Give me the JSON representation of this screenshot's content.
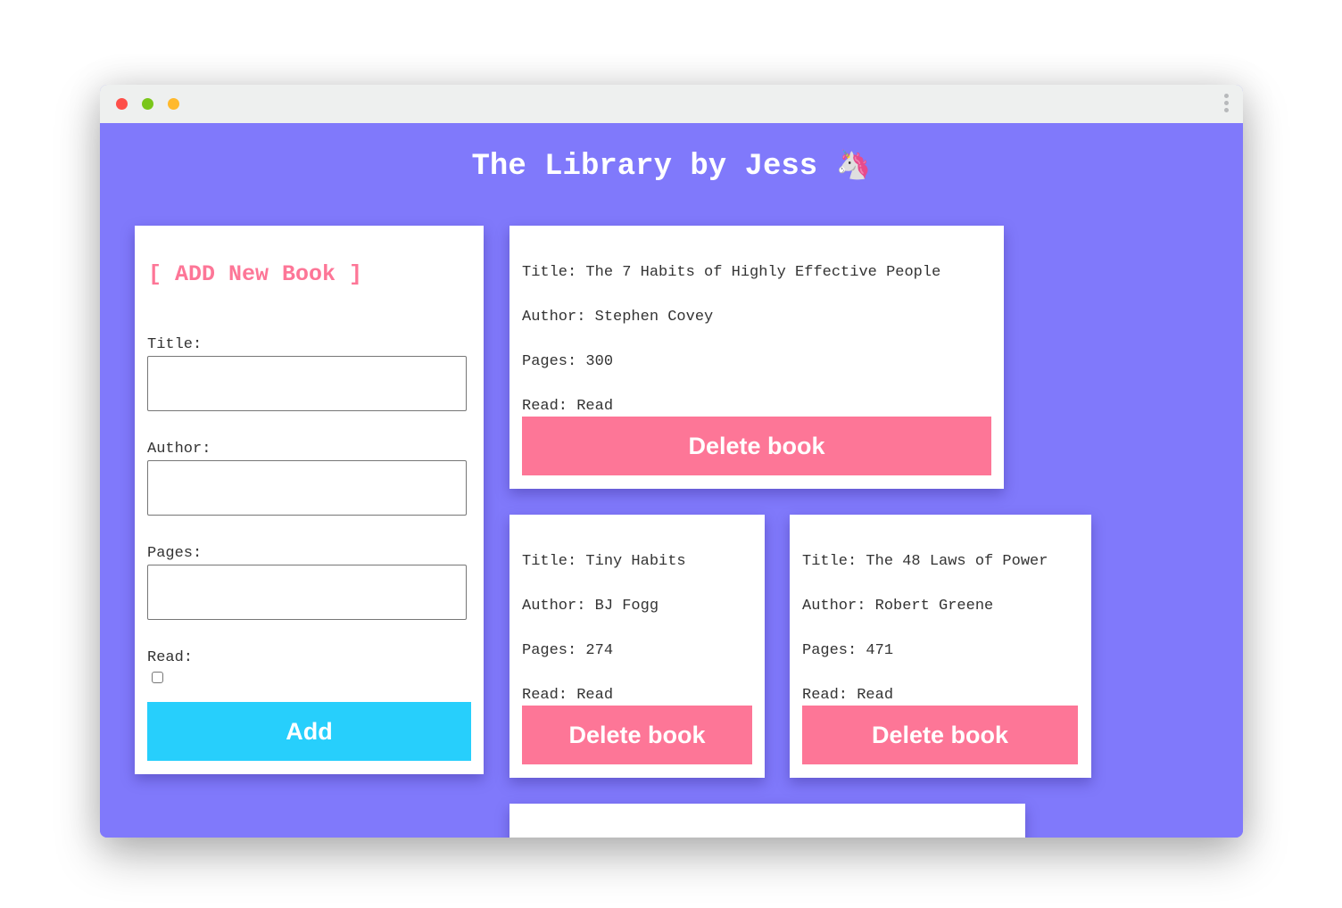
{
  "app": {
    "title": "The Library by Jess",
    "emoji": "🦄"
  },
  "form": {
    "heading": "[ ADD New Book ]",
    "title_label": "Title:",
    "title_value": "",
    "author_label": "Author:",
    "author_value": "",
    "pages_label": "Pages:",
    "pages_value": "",
    "read_label": "Read:",
    "read_checked": false,
    "add_label": "Add"
  },
  "books": [
    {
      "title": "Title: The 7 Habits of Highly Effective People",
      "author": "Author: Stephen Covey",
      "pages": "Pages: 300",
      "read": "Read: Read",
      "delete_label": "Delete book"
    },
    {
      "title": "Title: Tiny Habits",
      "author": "Author: BJ Fogg",
      "pages": "Pages: 274",
      "read": "Read: Read",
      "delete_label": "Delete book"
    },
    {
      "title": "Title: The 48 Laws of Power",
      "author": "Author: Robert Greene",
      "pages": "Pages: 471",
      "read": "Read: Read",
      "delete_label": "Delete book"
    }
  ],
  "colors": {
    "background": "#8079fb",
    "accent_pink": "#fd7697",
    "accent_cyan": "#27cffc",
    "titlebar": "#eef0ef"
  }
}
